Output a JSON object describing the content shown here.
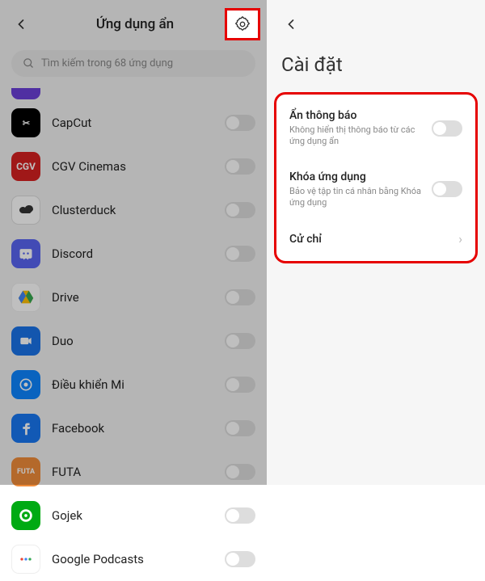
{
  "left": {
    "title": "Ứng dụng ẩn",
    "search_placeholder": "Tìm kiếm trong 68 ứng dụng",
    "apps": [
      {
        "name": "CapCut",
        "icon": "capcut"
      },
      {
        "name": "CGV Cinemas",
        "icon": "cgv"
      },
      {
        "name": "Clusterduck",
        "icon": "cluster"
      },
      {
        "name": "Discord",
        "icon": "discord"
      },
      {
        "name": "Drive",
        "icon": "drive"
      },
      {
        "name": "Duo",
        "icon": "duo"
      },
      {
        "name": "Điều khiển Mi",
        "icon": "mi"
      },
      {
        "name": "Facebook",
        "icon": "fb"
      },
      {
        "name": "FUTA",
        "icon": "futa"
      },
      {
        "name": "Gojek",
        "icon": "gojek"
      },
      {
        "name": "Google Podcasts",
        "icon": "gp"
      }
    ]
  },
  "right": {
    "title": "Cài đặt",
    "settings": [
      {
        "title": "Ẩn thông báo",
        "sub": "Không hiển thị thông báo từ các ứng dụng ẩn",
        "type": "toggle"
      },
      {
        "title": "Khóa ứng dụng",
        "sub": "Bảo vệ tập tin cá nhân bằng Khóa ứng dụng",
        "type": "toggle"
      },
      {
        "title": "Cử chỉ",
        "sub": "",
        "type": "link"
      }
    ]
  }
}
